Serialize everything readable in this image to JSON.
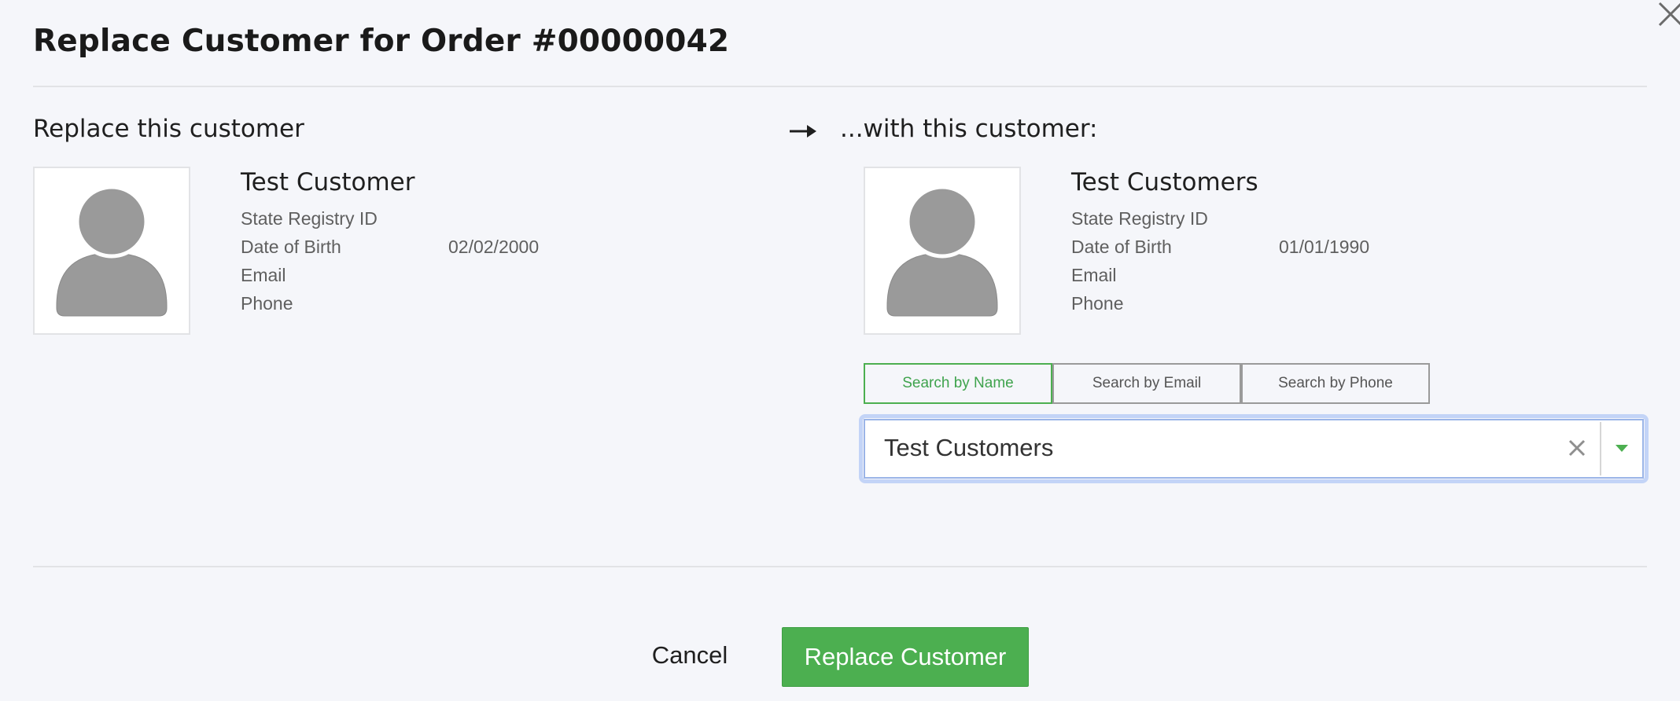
{
  "dialog": {
    "title": "Replace Customer for Order #00000042"
  },
  "left": {
    "heading": "Replace this customer",
    "customer": {
      "name": "Test Customer",
      "fields": [
        {
          "label": "State Registry ID",
          "value": ""
        },
        {
          "label": "Date of Birth",
          "value": "02/02/2000"
        },
        {
          "label": "Email",
          "value": ""
        },
        {
          "label": "Phone",
          "value": ""
        }
      ]
    }
  },
  "right": {
    "heading": "...with this customer:",
    "customer": {
      "name": "Test Customers",
      "fields": [
        {
          "label": "State Registry ID",
          "value": ""
        },
        {
          "label": "Date of Birth",
          "value": "01/01/1990"
        },
        {
          "label": "Email",
          "value": ""
        },
        {
          "label": "Phone",
          "value": ""
        }
      ]
    },
    "search_tabs": [
      {
        "label": "Search by Name",
        "active": true
      },
      {
        "label": "Search by Email",
        "active": false
      },
      {
        "label": "Search by Phone",
        "active": false
      }
    ],
    "select": {
      "value": "Test Customers"
    }
  },
  "footer": {
    "cancel_label": "Cancel",
    "replace_label": "Replace Customer"
  },
  "icons": {
    "close": "close-icon",
    "arrow": "arrow-right-icon",
    "avatar": "user-avatar-icon",
    "clear": "clear-icon",
    "dropdown": "caret-down-icon"
  },
  "colors": {
    "accent": "#4caf50",
    "focus_ring": "#c3d4f7",
    "avatar": "#9a9a9a",
    "background": "#f5f6fa"
  }
}
